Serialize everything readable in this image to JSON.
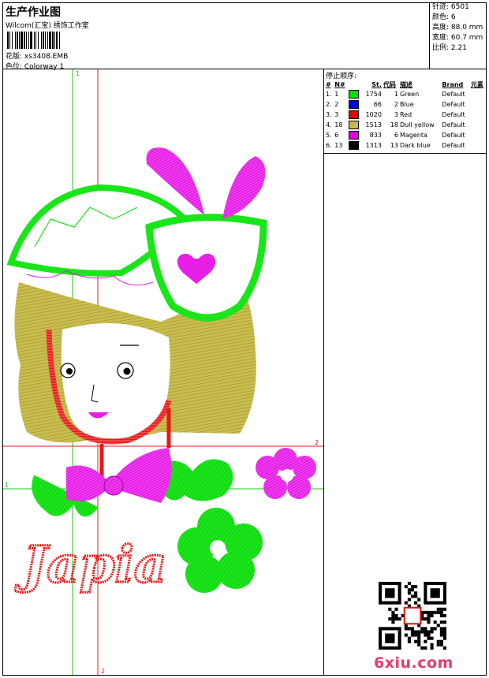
{
  "header": {
    "title": "生产作业图",
    "subtitle": "Wilcom(汇宝) 绣饰工作室",
    "design_line": "花版: xs3408.EMB",
    "colorway_line": "色位: Colorway 1"
  },
  "stats": {
    "stitches": "针迹: 6501",
    "colors": "颜色: 6",
    "height": "高度: 88.0 mm",
    "width": "宽度: 60.7 mm",
    "ratio": "比例: 2.21"
  },
  "stop_sequence": {
    "title": "停止顺序:",
    "headers": [
      "#",
      "N#",
      "St.",
      "代码",
      "描述",
      "Brand",
      "元素"
    ],
    "rows": [
      {
        "idx": "1.",
        "n": "1",
        "color": "#00e000",
        "st": "1754",
        "code": "1",
        "desc": "Green",
        "brand": "Default"
      },
      {
        "idx": "2.",
        "n": "2",
        "color": "#0000e0",
        "st": "66",
        "code": "2",
        "desc": "Blue",
        "brand": "Default"
      },
      {
        "idx": "3.",
        "n": "3",
        "color": "#e00000",
        "st": "1020",
        "code": "3",
        "desc": "Red",
        "brand": "Default"
      },
      {
        "idx": "4.",
        "n": "18",
        "color": "#c8b84a",
        "st": "1513",
        "code": "18",
        "desc": "Dull yellow",
        "brand": "Default"
      },
      {
        "idx": "5.",
        "n": "6",
        "color": "#e000e0",
        "st": "833",
        "code": "6",
        "desc": "Magenta",
        "brand": "Default"
      },
      {
        "idx": "6.",
        "n": "13",
        "color": "#000000",
        "st": "1313",
        "code": "13",
        "desc": "Dark blue",
        "brand": "Default"
      }
    ]
  },
  "artwork": {
    "guide_labels": [
      "1",
      "1",
      "2",
      "2"
    ],
    "text_on_design": "Japia",
    "thread_colors": {
      "green": "#19e619",
      "magenta": "#e61ee6",
      "red": "#e81818",
      "yellow": "#c9bd4c",
      "pink": "#ff6fd0"
    }
  },
  "watermark": "6xiu.com"
}
